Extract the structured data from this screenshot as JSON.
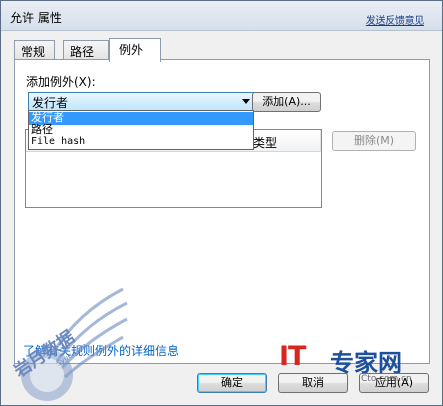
{
  "window": {
    "title": "允许 属性",
    "feedback_link": "发送反馈意见"
  },
  "tabs": [
    {
      "label": "常规",
      "active": false
    },
    {
      "label": "路径",
      "active": false
    },
    {
      "label": "例外",
      "active": true
    }
  ],
  "exceptions": {
    "add_label": "添加例外(X):",
    "combo_value": "发行者",
    "dropdown_options": [
      {
        "label": "发行者",
        "selected": true
      },
      {
        "label": "路径",
        "selected": false
      },
      {
        "label": "File hash",
        "selected": false
      }
    ],
    "add_button": "添加(A)...",
    "list_columns": [
      "类型"
    ],
    "delete_button": "删除(M)",
    "more_info_link": "了解有关规则例外的详细信息"
  },
  "footer": {
    "ok": "确定",
    "cancel": "取消",
    "apply": "应用(A)"
  },
  "watermarks": {
    "it_logo": "IT",
    "cn_logo": "专家网",
    "logo_domain": "Cto.com.cn",
    "left_text": "岩月数据",
    "left_domain": "5yue.com"
  },
  "colors": {
    "selection": "#3399ff",
    "link": "#0066cc",
    "it_red": "#d9261c",
    "it_blue": "#1c4f9c"
  }
}
